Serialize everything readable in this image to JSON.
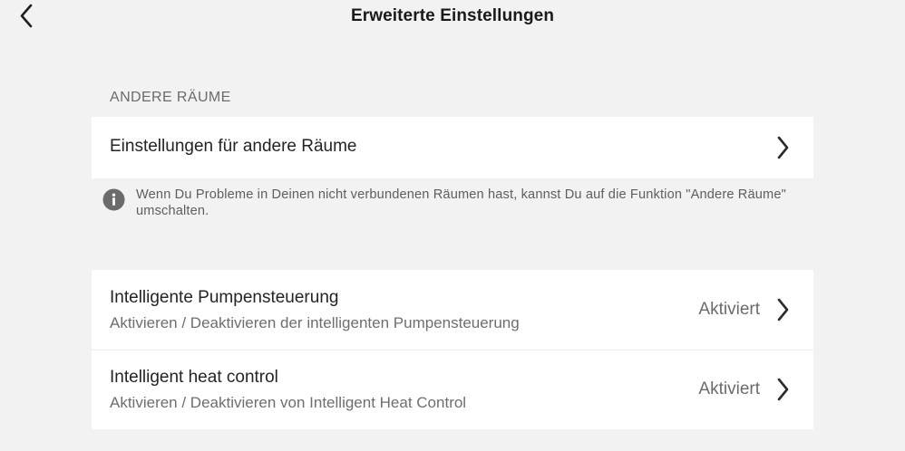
{
  "header": {
    "title": "Erweiterte Einstellungen",
    "back_icon": "chevron-left-icon"
  },
  "other_rooms": {
    "section_title": "ANDERE RÄUME",
    "row_label": "Einstellungen für andere Räume",
    "info_icon": "info-circle-icon",
    "info_text": "Wenn Du Probleme in Deinen nicht verbundenen Räumen hast, kannst Du auf die Funktion \"Andere Räume\" umschalten."
  },
  "features": [
    {
      "label": "Intelligente Pumpensteuerung",
      "sublabel": "Aktivieren / Deaktivieren der intelligenten Pumpensteuerung",
      "status": "Aktiviert"
    },
    {
      "label": "Intelligent heat control",
      "sublabel": "Aktivieren / Deaktivieren von Intelligent Heat Control",
      "status": "Aktiviert"
    }
  ],
  "colors": {
    "background": "#f2f2f2",
    "card": "#ffffff",
    "primary_text": "#242424",
    "secondary_text": "#6e6e6e",
    "info_icon": "#6b6b6b"
  }
}
